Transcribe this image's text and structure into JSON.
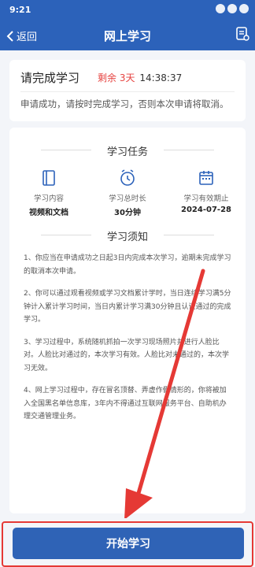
{
  "status_bar": {
    "time": "9:21"
  },
  "header": {
    "back_label": "返回",
    "title": "网上学习"
  },
  "summary": {
    "title": "请完成学习",
    "remain_prefix": "剩余",
    "remain_days": "3天",
    "remain_time": "14:38:37",
    "message": "申请成功，请按时完成学习，否则本次申请将取消。"
  },
  "task": {
    "heading": "学习任务",
    "items": [
      {
        "label": "学习内容",
        "value": "视频和文档",
        "icon": "document-icon"
      },
      {
        "label": "学习总时长",
        "value": "30分钟",
        "icon": "clock-icon"
      },
      {
        "label": "学习有效期止",
        "value": "2024-07-28",
        "icon": "calendar-icon"
      }
    ]
  },
  "notice": {
    "heading": "学习须知",
    "items": [
      "1、你应当在申请成功之日起3日内完成本次学习，逾期未完成学习的取消本次申请。",
      "2、你可以通过观看视频或学习文档累计学时，当日连续学习满5分钟计入累计学习时间，当日内累计学习满30分钟且认证通过的完成学习。",
      "3、学习过程中，系统随机抓拍一次学习现场照片并进行人脸比对。人脸比对通过的，本次学习有效。人脸比对未通过的，本次学习无效。",
      "4、网上学习过程中，存在冒名顶替、弄虚作假情形的，你将被加入全国黑名单信息库，3年内不得通过互联网服务平台、自助机办理交通管理业务。"
    ]
  },
  "footer": {
    "start_label": "开始学习"
  },
  "colors": {
    "primary": "#2c62ba",
    "alert": "#e64340",
    "annotation": "#e53935"
  }
}
